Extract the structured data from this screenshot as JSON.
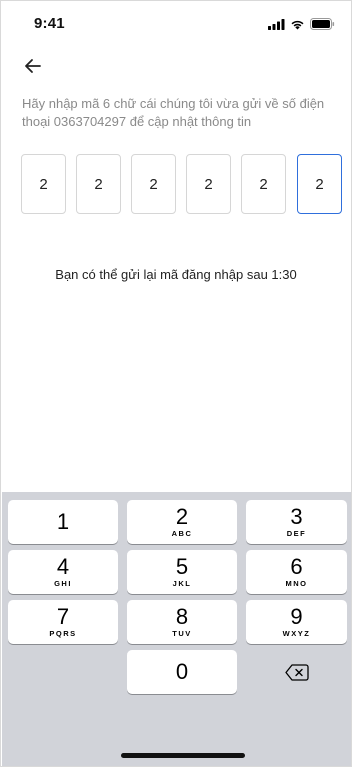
{
  "status_bar": {
    "time": "9:41"
  },
  "instruction": "Hãy nhập mã 6 chữ cái chúng tôi vừa gửi về số điện thoại 0363704297 để cập nhật thông tin",
  "otp_digits": [
    "2",
    "2",
    "2",
    "2",
    "2",
    "2"
  ],
  "resend_text": "Bạn có thể gửi lại mã đăng nhập sau 1:30",
  "keypad": {
    "keys": [
      {
        "num": "1",
        "letters": ""
      },
      {
        "num": "2",
        "letters": "ABC"
      },
      {
        "num": "3",
        "letters": "DEF"
      },
      {
        "num": "4",
        "letters": "GHI"
      },
      {
        "num": "5",
        "letters": "JKL"
      },
      {
        "num": "6",
        "letters": "MNO"
      },
      {
        "num": "7",
        "letters": "PQRS"
      },
      {
        "num": "8",
        "letters": "TUV"
      },
      {
        "num": "9",
        "letters": "WXYZ"
      },
      {
        "num": "0",
        "letters": ""
      }
    ]
  },
  "icons": {
    "back": "back-arrow-icon",
    "signal": "cellular-signal-icon",
    "wifi": "wifi-icon",
    "battery": "battery-icon",
    "delete": "backspace-icon"
  },
  "colors": {
    "active_border": "#2f6fdc",
    "hint_text": "#8a8a8a",
    "keyboard_bg": "#d1d3d9"
  }
}
